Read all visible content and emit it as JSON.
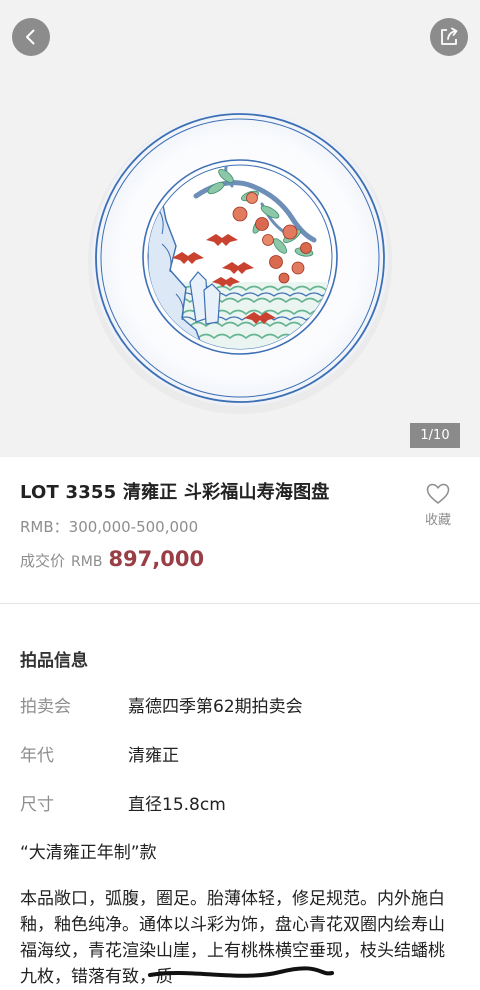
{
  "gallery": {
    "counter": "1/10",
    "accent_colors": {
      "underglaze_blue": "#3d6fb5",
      "iron_red": "#c9412f",
      "green_enamel": "#67b493"
    }
  },
  "icons": {
    "back": "chevron-left-icon",
    "share": "share-icon",
    "favorite": "heart-outline-icon"
  },
  "lot": {
    "title": "LOT 3355 清雍正  斗彩福山寿海图盘",
    "estimate": "RMB：300,000-500,000",
    "deal_label": "成交价",
    "deal_currency": "RMB",
    "deal_price": "897,000",
    "favorite_label": "收藏"
  },
  "info": {
    "section_title": "拍品信息",
    "rows": [
      {
        "key": "拍卖会",
        "value": "嘉德四季第62期拍卖会"
      },
      {
        "key": "年代",
        "value": "清雍正"
      },
      {
        "key": "尺寸",
        "value": "直径15.8cm"
      }
    ],
    "mark": "“大清雍正年制”款",
    "description": "本品敞口，弧腹，圈足。胎薄体轻，修足规范。内外施白釉，釉色纯净。通体以斗彩为饰，盘心青花双圈内绘寿山福海纹，青花渲染山崖，上有桃株横空垂现，枝头结蟠桃九枚，错落有致，质"
  },
  "colors": {
    "price": "#9a3e46",
    "muted": "#8e8e8e",
    "hero_background": "#f2f2f2"
  }
}
